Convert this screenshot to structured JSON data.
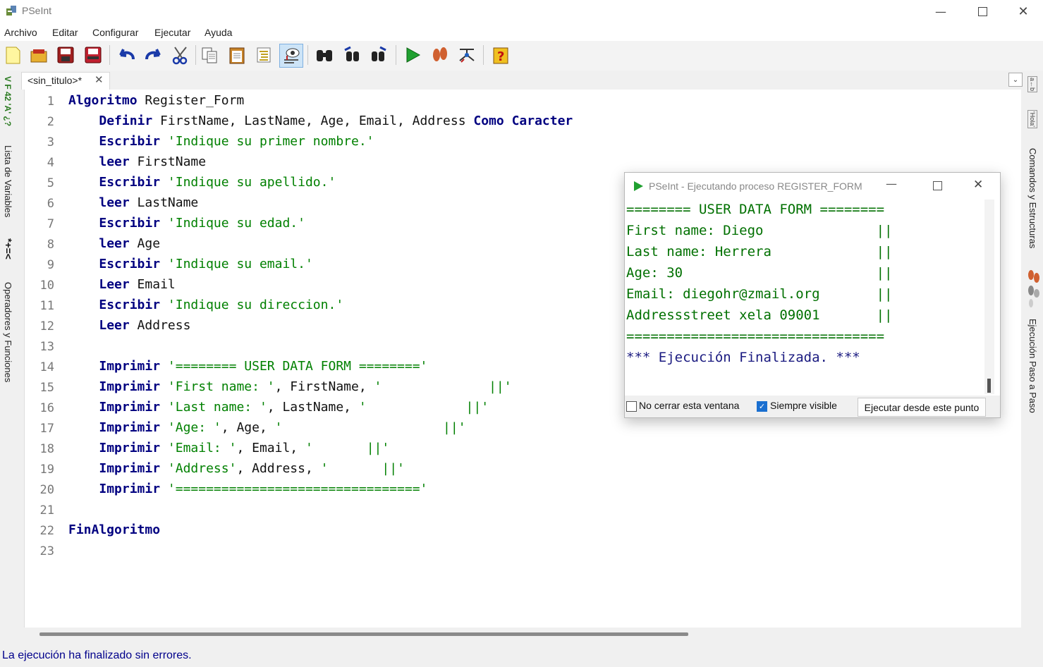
{
  "window": {
    "title": "PSeInt"
  },
  "menu": [
    "Archivo",
    "Editar",
    "Configurar",
    "Ejecutar",
    "Ayuda"
  ],
  "toolbar_icons": [
    "new-file-icon",
    "open-file-icon",
    "save-icon",
    "save-as-icon",
    "undo-icon",
    "redo-icon",
    "cut-icon",
    "copy-icon",
    "paste-icon",
    "indent-icon",
    "view-icon",
    "find-icon",
    "find-previous-icon",
    "find-next-icon",
    "run-icon",
    "step-by-step-icon",
    "diagram-icon",
    "help-icon"
  ],
  "left_panel": {
    "variables": "Lista de Variables",
    "operators": "Operadores y Funciones",
    "var_glyph": "V F 42 'A' ¿?",
    "op_glyph": "*+=<"
  },
  "right_panel": {
    "commands": "Comandos y Estructuras",
    "step": "Ejecución Paso a Paso",
    "glyph1": "a←b",
    "glyph2": "'Hola'"
  },
  "tab": {
    "label": "<sin_titulo>*",
    "close": "✕"
  },
  "editor": {
    "lines": [
      {
        "n": "1",
        "tokens": [
          {
            "t": "kw",
            "v": "Algoritmo"
          },
          {
            "t": "txt",
            "v": " Register_Form"
          }
        ]
      },
      {
        "n": "2",
        "tokens": [
          {
            "t": "txt",
            "v": "    "
          },
          {
            "t": "kw",
            "v": "Definir"
          },
          {
            "t": "txt",
            "v": " FirstName, LastName, Age, Email, Address "
          },
          {
            "t": "kw",
            "v": "Como"
          },
          {
            "t": "txt",
            "v": " "
          },
          {
            "t": "kw",
            "v": "Caracter"
          }
        ]
      },
      {
        "n": "3",
        "tokens": [
          {
            "t": "txt",
            "v": "    "
          },
          {
            "t": "kw",
            "v": "Escribir"
          },
          {
            "t": "txt",
            "v": " "
          },
          {
            "t": "str",
            "v": "'Indique su primer nombre.'"
          }
        ]
      },
      {
        "n": "4",
        "tokens": [
          {
            "t": "txt",
            "v": "    "
          },
          {
            "t": "kw",
            "v": "leer"
          },
          {
            "t": "txt",
            "v": " FirstName"
          }
        ]
      },
      {
        "n": "5",
        "tokens": [
          {
            "t": "txt",
            "v": "    "
          },
          {
            "t": "kw",
            "v": "Escribir"
          },
          {
            "t": "txt",
            "v": " "
          },
          {
            "t": "str",
            "v": "'Indique su apellido.'"
          }
        ]
      },
      {
        "n": "6",
        "tokens": [
          {
            "t": "txt",
            "v": "    "
          },
          {
            "t": "kw",
            "v": "leer"
          },
          {
            "t": "txt",
            "v": " LastName"
          }
        ]
      },
      {
        "n": "7",
        "tokens": [
          {
            "t": "txt",
            "v": "    "
          },
          {
            "t": "kw",
            "v": "Escribir"
          },
          {
            "t": "txt",
            "v": " "
          },
          {
            "t": "str",
            "v": "'Indique su edad.'"
          }
        ]
      },
      {
        "n": "8",
        "tokens": [
          {
            "t": "txt",
            "v": "    "
          },
          {
            "t": "kw",
            "v": "leer"
          },
          {
            "t": "txt",
            "v": " Age"
          }
        ]
      },
      {
        "n": "9",
        "tokens": [
          {
            "t": "txt",
            "v": "    "
          },
          {
            "t": "kw",
            "v": "Escribir"
          },
          {
            "t": "txt",
            "v": " "
          },
          {
            "t": "str",
            "v": "'Indique su email.'"
          }
        ]
      },
      {
        "n": "10",
        "tokens": [
          {
            "t": "txt",
            "v": "    "
          },
          {
            "t": "kw",
            "v": "Leer"
          },
          {
            "t": "txt",
            "v": " Email"
          }
        ]
      },
      {
        "n": "11",
        "tokens": [
          {
            "t": "txt",
            "v": "    "
          },
          {
            "t": "kw",
            "v": "Escribir"
          },
          {
            "t": "txt",
            "v": " "
          },
          {
            "t": "str",
            "v": "'Indique su direccion.'"
          }
        ]
      },
      {
        "n": "12",
        "tokens": [
          {
            "t": "txt",
            "v": "    "
          },
          {
            "t": "kw",
            "v": "Leer"
          },
          {
            "t": "txt",
            "v": " Address"
          }
        ]
      },
      {
        "n": "13",
        "tokens": []
      },
      {
        "n": "14",
        "tokens": [
          {
            "t": "txt",
            "v": "    "
          },
          {
            "t": "kw",
            "v": "Imprimir"
          },
          {
            "t": "txt",
            "v": " "
          },
          {
            "t": "str",
            "v": "'======== USER DATA FORM ========'"
          }
        ]
      },
      {
        "n": "15",
        "tokens": [
          {
            "t": "txt",
            "v": "    "
          },
          {
            "t": "kw",
            "v": "Imprimir"
          },
          {
            "t": "txt",
            "v": " "
          },
          {
            "t": "str",
            "v": "'First name: '"
          },
          {
            "t": "txt",
            "v": ", FirstName, "
          },
          {
            "t": "str",
            "v": "'              ||'"
          }
        ]
      },
      {
        "n": "16",
        "tokens": [
          {
            "t": "txt",
            "v": "    "
          },
          {
            "t": "kw",
            "v": "Imprimir"
          },
          {
            "t": "txt",
            "v": " "
          },
          {
            "t": "str",
            "v": "'Last name: '"
          },
          {
            "t": "txt",
            "v": ", LastName, "
          },
          {
            "t": "str",
            "v": "'             ||'"
          }
        ]
      },
      {
        "n": "17",
        "tokens": [
          {
            "t": "txt",
            "v": "    "
          },
          {
            "t": "kw",
            "v": "Imprimir"
          },
          {
            "t": "txt",
            "v": " "
          },
          {
            "t": "str",
            "v": "'Age: '"
          },
          {
            "t": "txt",
            "v": ", Age, "
          },
          {
            "t": "str",
            "v": "'                     ||'"
          }
        ]
      },
      {
        "n": "18",
        "tokens": [
          {
            "t": "txt",
            "v": "    "
          },
          {
            "t": "kw",
            "v": "Imprimir"
          },
          {
            "t": "txt",
            "v": " "
          },
          {
            "t": "str",
            "v": "'Email: '"
          },
          {
            "t": "txt",
            "v": ", Email, "
          },
          {
            "t": "str",
            "v": "'       ||'"
          }
        ]
      },
      {
        "n": "19",
        "tokens": [
          {
            "t": "txt",
            "v": "    "
          },
          {
            "t": "kw",
            "v": "Imprimir"
          },
          {
            "t": "txt",
            "v": " "
          },
          {
            "t": "str",
            "v": "'Address'"
          },
          {
            "t": "txt",
            "v": ", Address, "
          },
          {
            "t": "str",
            "v": "'       ||'"
          }
        ]
      },
      {
        "n": "20",
        "tokens": [
          {
            "t": "txt",
            "v": "    "
          },
          {
            "t": "kw",
            "v": "Imprimir"
          },
          {
            "t": "txt",
            "v": " "
          },
          {
            "t": "str",
            "v": "'================================'"
          }
        ]
      },
      {
        "n": "21",
        "tokens": []
      },
      {
        "n": "22",
        "tokens": [
          {
            "t": "kw",
            "v": "FinAlgoritmo"
          }
        ]
      },
      {
        "n": "23",
        "tokens": []
      }
    ]
  },
  "status": "La ejecución ha finalizado sin errores.",
  "run_window": {
    "title": "PSeInt - Ejecutando proceso REGISTER_FORM",
    "output": [
      {
        "text": "======== USER DATA FORM ========",
        "color": "#007000"
      },
      {
        "text": "First name: Diego              ||",
        "color": "#007000"
      },
      {
        "text": "Last name: Herrera             ||",
        "color": "#007000"
      },
      {
        "text": "Age: 30                        ||",
        "color": "#007000"
      },
      {
        "text": "Email: diegohr@zmail.org       ||",
        "color": "#007000"
      },
      {
        "text": "Addressstreet xela 09001       ||",
        "color": "#007000"
      },
      {
        "text": "================================",
        "color": "#007000"
      },
      {
        "text": "*** Ejecución Finalizada. ***",
        "color": "#1a1a80"
      }
    ],
    "no_close_label": "No cerrar esta ventana",
    "no_close_checked": false,
    "always_visible_label": "Siempre visible",
    "always_visible_checked": true,
    "run_from_here_label": "Ejecutar desde este punto"
  }
}
